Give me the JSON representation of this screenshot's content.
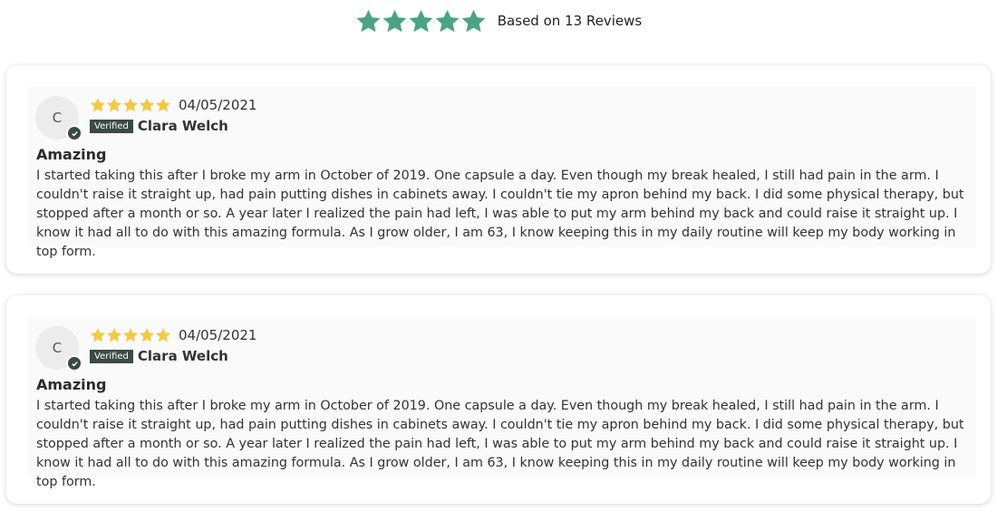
{
  "summary": {
    "stars": 5,
    "star_color": "#4aa481",
    "text": "Based on 13 Reviews"
  },
  "reviews": [
    {
      "avatar_initial": "C",
      "rating": 5,
      "star_color": "#f5c842",
      "date": "04/05/2021",
      "verified_label": "Verified",
      "author": "Clara Welch",
      "title": "Amazing",
      "body": "I started taking this after I broke my arm in October of 2019. One capsule a day. Even though my break healed, I still had pain in the arm. I couldn't raise it straight up, had pain putting dishes in cabinets away. I couldn't tie my apron behind my back. I did some physical therapy, but stopped after a month or so. A year later I realized the pain had left, I was able to put my arm behind my back and could raise it straight up. I know it had all to do with this amazing formula. As I grow older, I am 63, I know keeping this in my daily routine will keep my body working in top form."
    },
    {
      "avatar_initial": "C",
      "rating": 5,
      "star_color": "#f5c842",
      "date": "04/05/2021",
      "verified_label": "Verified",
      "author": "Clara Welch",
      "title": "Amazing",
      "body": "I started taking this after I broke my arm in October of 2019. One capsule a day. Even though my break healed, I still had pain in the arm. I couldn't raise it straight up, had pain putting dishes in cabinets away. I couldn't tie my apron behind my back. I did some physical therapy, but stopped after a month or so. A year later I realized the pain had left, I was able to put my arm behind my back and could raise it straight up. I know it had all to do with this amazing formula. As I grow older, I am 63, I know keeping this in my daily routine will keep my body working in top form."
    }
  ],
  "icons": {
    "star": "star-icon",
    "verified_check": "check-icon"
  }
}
